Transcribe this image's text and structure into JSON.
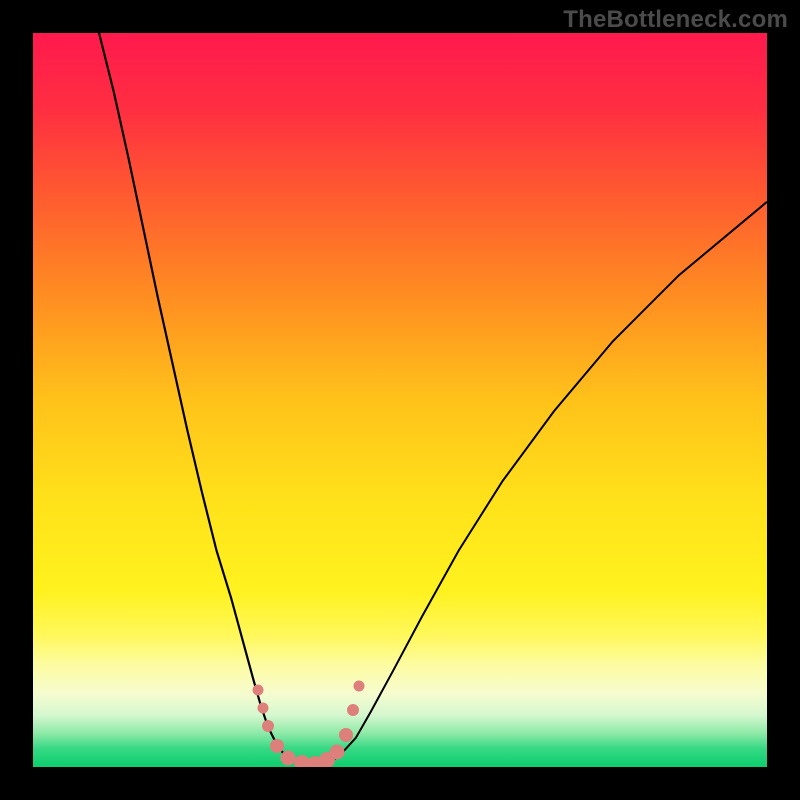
{
  "watermark": "TheBottleneck.com",
  "colors": {
    "frame": "#000000",
    "curve": "#000000",
    "dot": "#dd7f7a"
  },
  "gradient_stops": [
    {
      "offset": 0.0,
      "color": "#ff1a4d"
    },
    {
      "offset": 0.1,
      "color": "#ff2d42"
    },
    {
      "offset": 0.22,
      "color": "#ff5a30"
    },
    {
      "offset": 0.35,
      "color": "#ff8a22"
    },
    {
      "offset": 0.5,
      "color": "#ffc21a"
    },
    {
      "offset": 0.64,
      "color": "#ffe21a"
    },
    {
      "offset": 0.76,
      "color": "#fff21f"
    },
    {
      "offset": 0.82,
      "color": "#fff85a"
    },
    {
      "offset": 0.86,
      "color": "#fdfca0"
    },
    {
      "offset": 0.9,
      "color": "#f6fccf"
    },
    {
      "offset": 0.93,
      "color": "#d4f7cf"
    },
    {
      "offset": 0.955,
      "color": "#8ae9a5"
    },
    {
      "offset": 0.975,
      "color": "#36d884"
    },
    {
      "offset": 1.0,
      "color": "#0ccf6d"
    }
  ],
  "chart_data": {
    "type": "line",
    "title": "",
    "xlabel": "",
    "ylabel": "",
    "x_range": [
      0,
      100
    ],
    "y_range": [
      0,
      100
    ],
    "curves": {
      "left": [
        {
          "x": 9.0,
          "y": 100.0
        },
        {
          "x": 11.0,
          "y": 92.0
        },
        {
          "x": 13.0,
          "y": 83.0
        },
        {
          "x": 15.0,
          "y": 73.5
        },
        {
          "x": 17.0,
          "y": 64.0
        },
        {
          "x": 19.0,
          "y": 55.0
        },
        {
          "x": 21.0,
          "y": 46.0
        },
        {
          "x": 23.0,
          "y": 37.5
        },
        {
          "x": 25.0,
          "y": 29.5
        },
        {
          "x": 27.0,
          "y": 23.0
        },
        {
          "x": 28.5,
          "y": 17.5
        },
        {
          "x": 30.0,
          "y": 12.0
        },
        {
          "x": 31.0,
          "y": 8.5
        },
        {
          "x": 32.0,
          "y": 5.5
        },
        {
          "x": 33.0,
          "y": 3.5
        },
        {
          "x": 34.0,
          "y": 2.0
        },
        {
          "x": 35.5,
          "y": 0.9
        },
        {
          "x": 37.0,
          "y": 0.35
        },
        {
          "x": 39.0,
          "y": 0.2
        }
      ],
      "right": [
        {
          "x": 39.0,
          "y": 0.2
        },
        {
          "x": 40.5,
          "y": 0.6
        },
        {
          "x": 42.0,
          "y": 1.8
        },
        {
          "x": 44.0,
          "y": 4.0
        },
        {
          "x": 46.0,
          "y": 7.5
        },
        {
          "x": 49.0,
          "y": 13.0
        },
        {
          "x": 53.0,
          "y": 20.5
        },
        {
          "x": 58.0,
          "y": 29.5
        },
        {
          "x": 64.0,
          "y": 39.0
        },
        {
          "x": 71.0,
          "y": 48.5
        },
        {
          "x": 79.0,
          "y": 58.0
        },
        {
          "x": 88.0,
          "y": 67.0
        },
        {
          "x": 97.0,
          "y": 74.5
        },
        {
          "x": 100.0,
          "y": 77.0
        }
      ]
    },
    "points": [
      {
        "x": 30.6,
        "y": 10.5,
        "size": 11
      },
      {
        "x": 31.4,
        "y": 8.0,
        "size": 11
      },
      {
        "x": 32.0,
        "y": 5.6,
        "size": 12
      },
      {
        "x": 33.2,
        "y": 2.8,
        "size": 14
      },
      {
        "x": 34.8,
        "y": 1.2,
        "size": 15
      },
      {
        "x": 36.6,
        "y": 0.55,
        "size": 16
      },
      {
        "x": 38.4,
        "y": 0.45,
        "size": 16
      },
      {
        "x": 40.0,
        "y": 0.9,
        "size": 16
      },
      {
        "x": 41.4,
        "y": 2.1,
        "size": 15
      },
      {
        "x": 42.6,
        "y": 4.3,
        "size": 14
      },
      {
        "x": 43.6,
        "y": 7.8,
        "size": 12
      },
      {
        "x": 44.4,
        "y": 11.0,
        "size": 11
      }
    ]
  }
}
